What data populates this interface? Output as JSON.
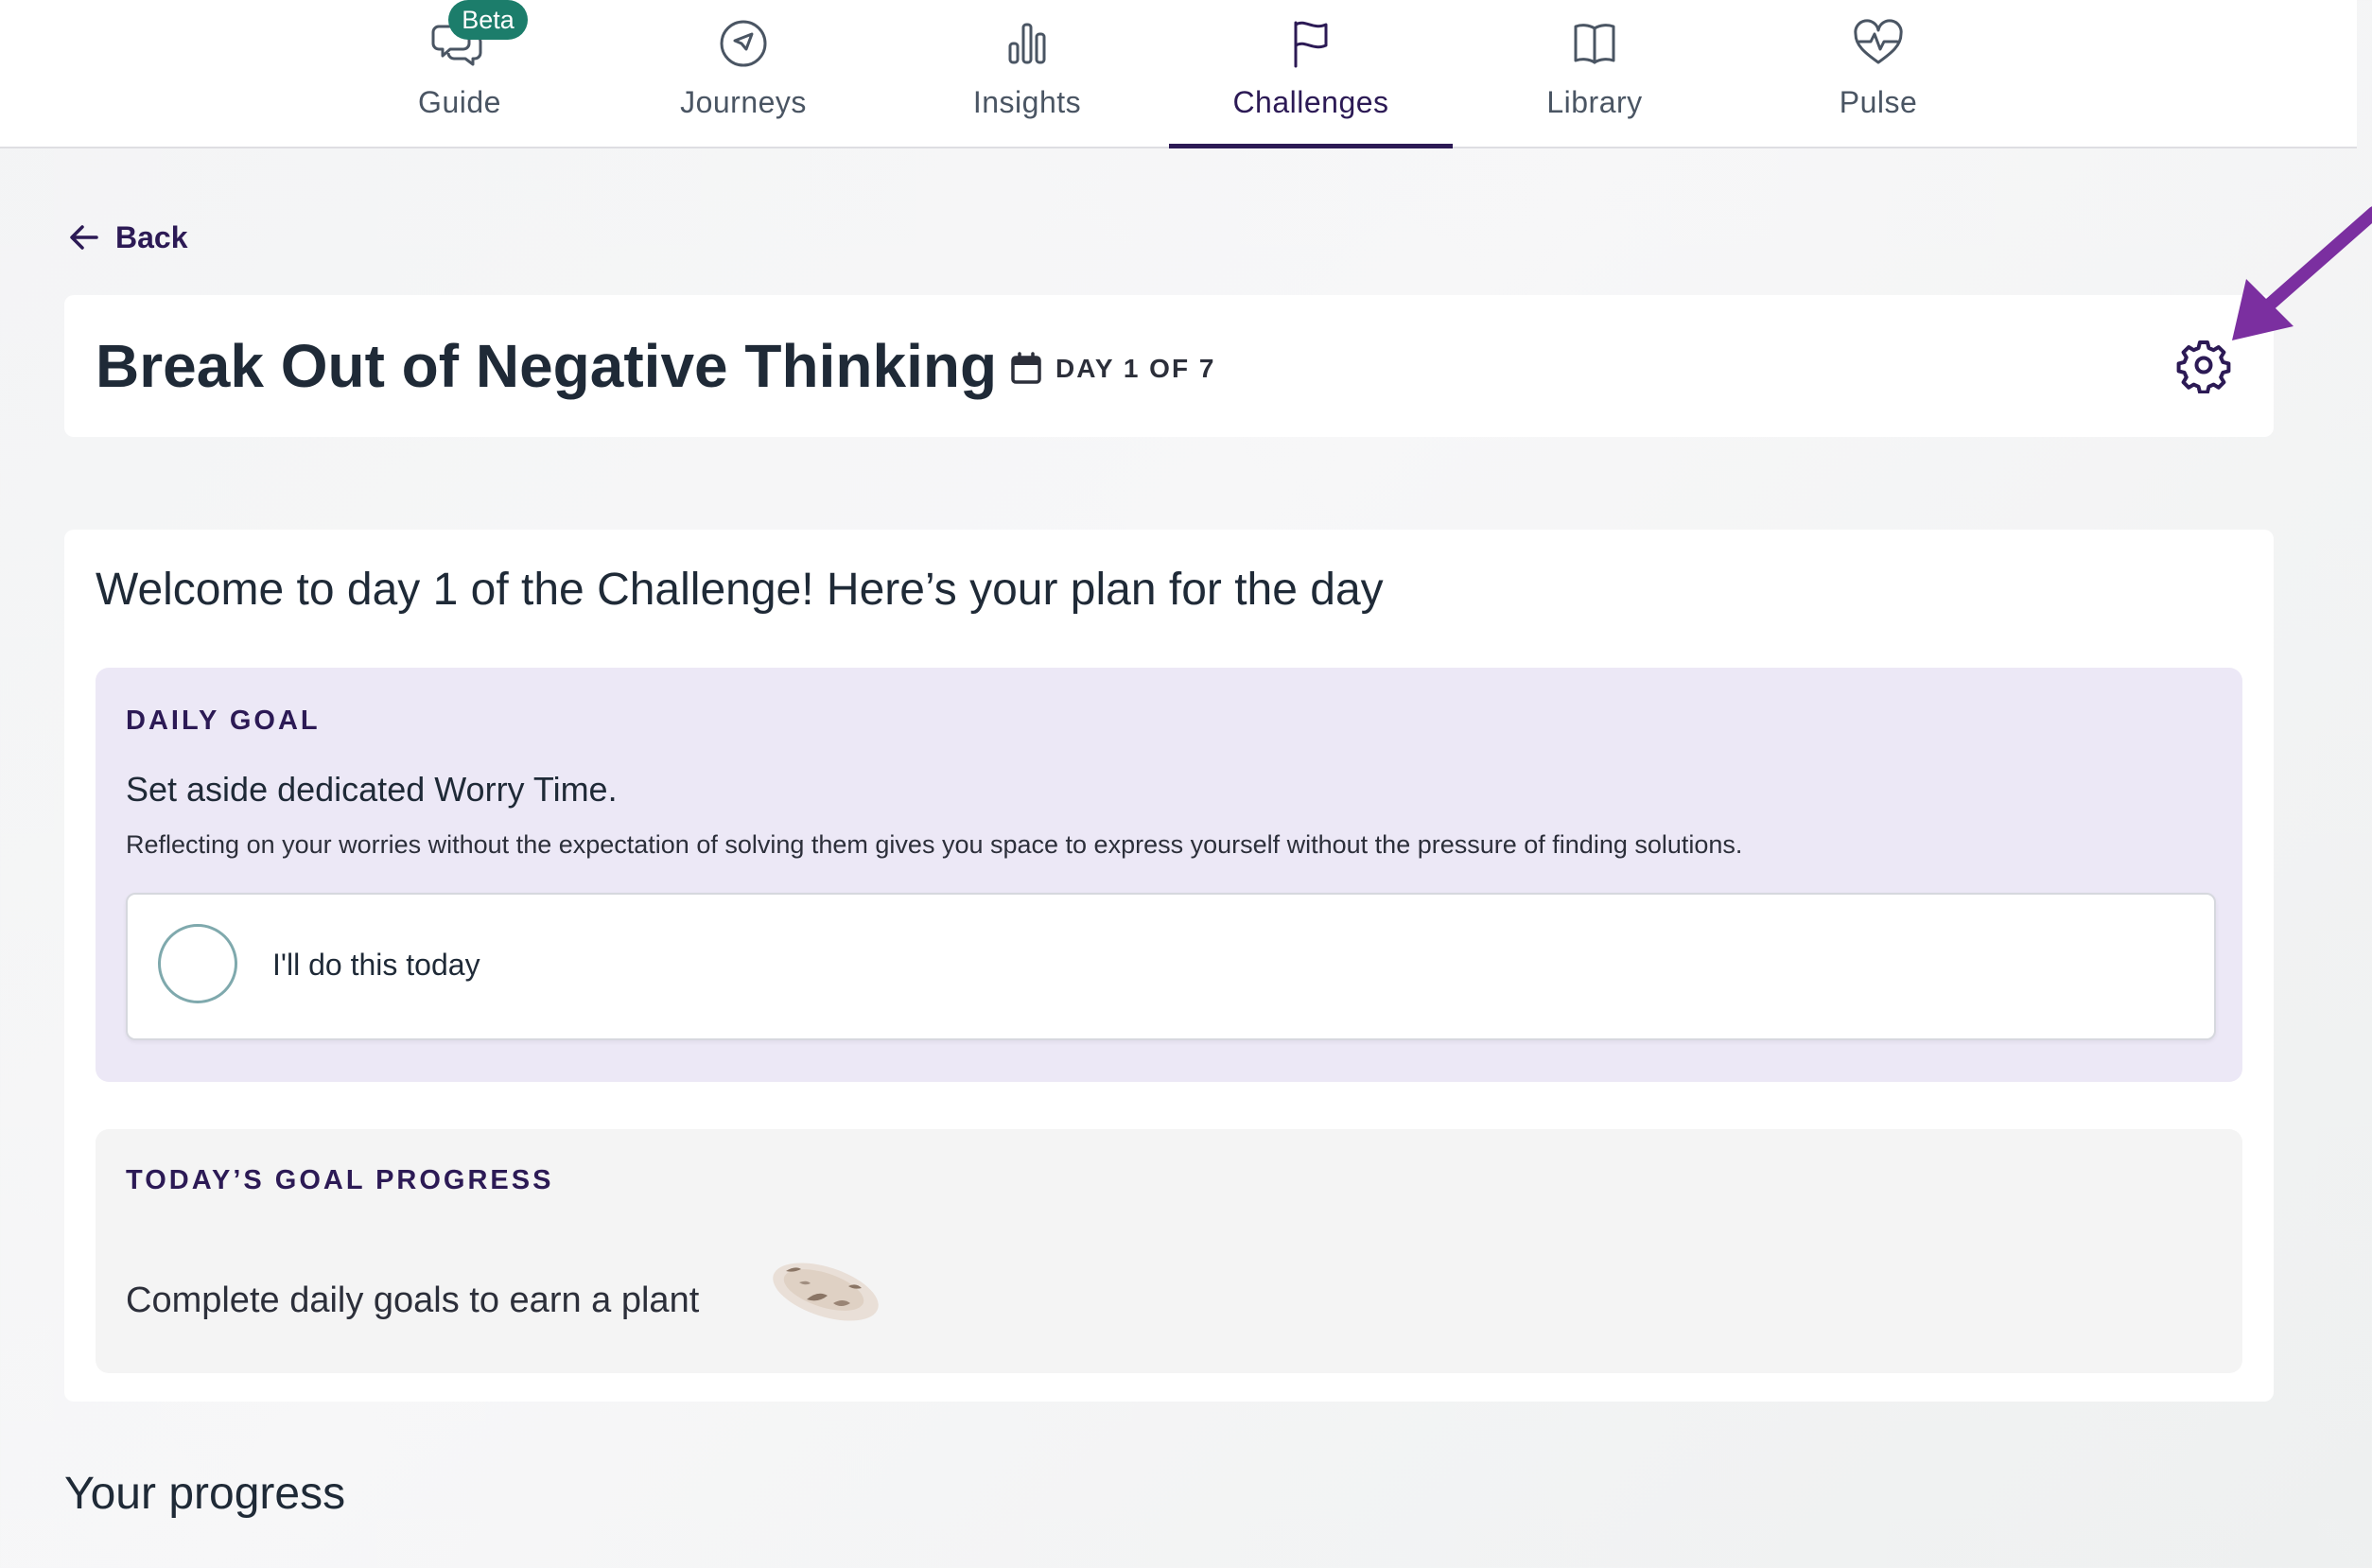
{
  "nav": {
    "tabs": [
      {
        "label": "Guide",
        "icon": "chat-bubbles-icon",
        "badge": "Beta",
        "active": false
      },
      {
        "label": "Journeys",
        "icon": "compass-icon",
        "active": false
      },
      {
        "label": "Insights",
        "icon": "bar-chart-icon",
        "active": false
      },
      {
        "label": "Challenges",
        "icon": "flag-icon",
        "active": true
      },
      {
        "label": "Library",
        "icon": "book-icon",
        "active": false
      },
      {
        "label": "Pulse",
        "icon": "heart-pulse-icon",
        "active": false
      }
    ]
  },
  "back": {
    "label": "Back",
    "icon": "arrow-left-icon"
  },
  "challenge": {
    "title": "Break Out of Negative Thinking",
    "day_label": "DAY 1 OF 7",
    "day_icon": "calendar-icon",
    "settings_icon": "gear-icon"
  },
  "plan": {
    "welcome": "Welcome to day 1 of the Challenge! Here’s your plan for the day",
    "daily_goal": {
      "eyebrow": "DAILY GOAL",
      "title": "Set aside dedicated Worry Time.",
      "description": "Reflecting on your worries without the expectation of solving them gives you space to express yourself without the pressure of finding solutions.",
      "commit_label": "I'll do this today",
      "checked": false
    },
    "progress": {
      "eyebrow": "TODAY’S GOAL PROGRESS",
      "text": "Complete daily goals to earn a plant",
      "plant_icon": "seed-soil-icon"
    }
  },
  "your_progress": {
    "heading": "Your progress"
  },
  "colors": {
    "accent": "#2c1a55",
    "badge": "#1c7d6b",
    "goal_panel_bg": "#ece8f6",
    "progress_panel_bg": "#f4f4f4",
    "annotation_arrow": "#7b2fa0"
  }
}
